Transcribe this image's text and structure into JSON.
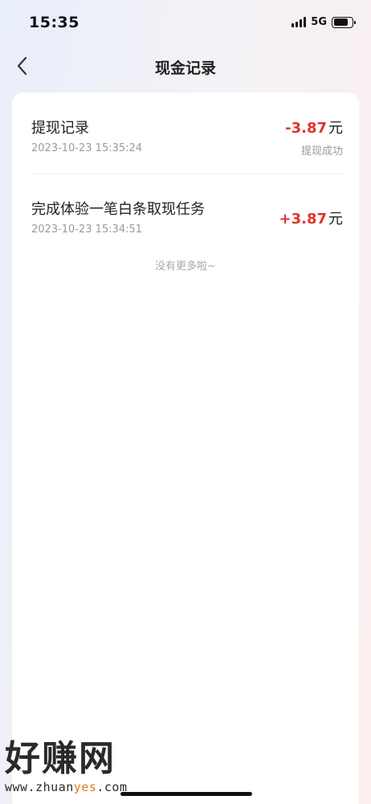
{
  "status_bar": {
    "time": "15:35",
    "network": "5G"
  },
  "nav": {
    "title": "现金记录"
  },
  "records": [
    {
      "title": "提现记录",
      "date": "2023-10-23 15:35:24",
      "amount": "-3.87",
      "unit": "元",
      "status": "提现成功"
    },
    {
      "title": "完成体验一笔白条取现任务",
      "date": "2023-10-23 15:34:51",
      "amount": "+3.87",
      "unit": "元",
      "status": ""
    }
  ],
  "footer": {
    "no_more": "没有更多啦~"
  },
  "watermark": {
    "brand": "好赚网",
    "url_pre": "www.zhuan",
    "url_accent": "yes",
    "url_post": ".com"
  },
  "colors": {
    "amount": "#e0332c",
    "accent": "#e07a1c"
  }
}
